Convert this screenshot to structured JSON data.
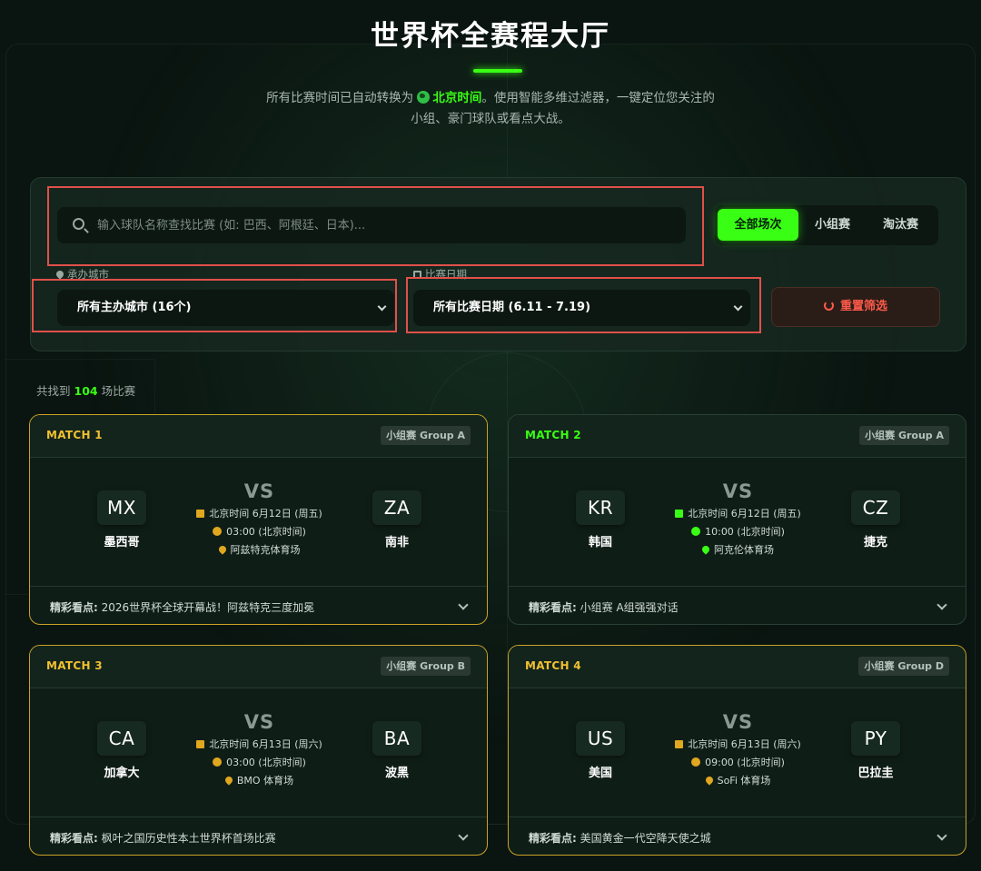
{
  "header": {
    "title": "世界杯全赛程大厅",
    "subtitle_pre": "所有比赛时间已自动转换为",
    "subtitle_highlight": "北京时间",
    "subtitle_post": "。使用智能多维过滤器，一键定位您关注的",
    "subtitle_line2": "小组、豪门球队或看点大战。",
    "accent_color": "#39ff14"
  },
  "filters": {
    "search_placeholder": "输入球队名称查找比赛 (如: 巴西、阿根廷、日本)...",
    "search_value": "",
    "tabs": [
      {
        "label": "全部场次",
        "active": true
      },
      {
        "label": "小组赛",
        "active": false
      },
      {
        "label": "淘汰赛",
        "active": false
      }
    ],
    "city_label": "承办城市",
    "city_selected": "所有主办城市 (16个)",
    "date_label": "比赛日期",
    "date_selected": "所有比赛日期 (6.11 - 7.19)",
    "reset_label": "重置筛选"
  },
  "results": {
    "prefix": "共找到",
    "count": "104",
    "suffix": "场比赛"
  },
  "matches": [
    {
      "no": "MATCH 1",
      "group": "小组赛 Group A",
      "home_code": "MX",
      "home_name": "墨西哥",
      "away_code": "ZA",
      "away_name": "南非",
      "date": "北京时间 6月12日 (周五)",
      "time": "03:00 (北京时间)",
      "venue": "阿兹特克体育场",
      "highlight_label": "精彩看点:",
      "highlight": "2026世界杯全球开幕战！阿兹特克三度加冕"
    },
    {
      "no": "MATCH 2",
      "group": "小组赛 Group A",
      "home_code": "KR",
      "home_name": "韩国",
      "away_code": "CZ",
      "away_name": "捷克",
      "date": "北京时间 6月12日 (周五)",
      "time": "10:00 (北京时间)",
      "venue": "阿克伦体育场",
      "highlight_label": "精彩看点:",
      "highlight": "小组赛 A组强强对话"
    },
    {
      "no": "MATCH 3",
      "group": "小组赛 Group B",
      "home_code": "CA",
      "home_name": "加拿大",
      "away_code": "BA",
      "away_name": "波黑",
      "date": "北京时间 6月13日 (周六)",
      "time": "03:00 (北京时间)",
      "venue": "BMO 体育场",
      "highlight_label": "精彩看点:",
      "highlight": "枫叶之国历史性本土世界杯首场比赛"
    },
    {
      "no": "MATCH 4",
      "group": "小组赛 Group D",
      "home_code": "US",
      "home_name": "美国",
      "away_code": "PY",
      "away_name": "巴拉圭",
      "date": "北京时间 6月13日 (周六)",
      "time": "09:00 (北京时间)",
      "venue": "SoFi 体育场",
      "highlight_label": "精彩看点:",
      "highlight": "美国黄金一代空降天使之城"
    }
  ],
  "vs_label": "VS"
}
